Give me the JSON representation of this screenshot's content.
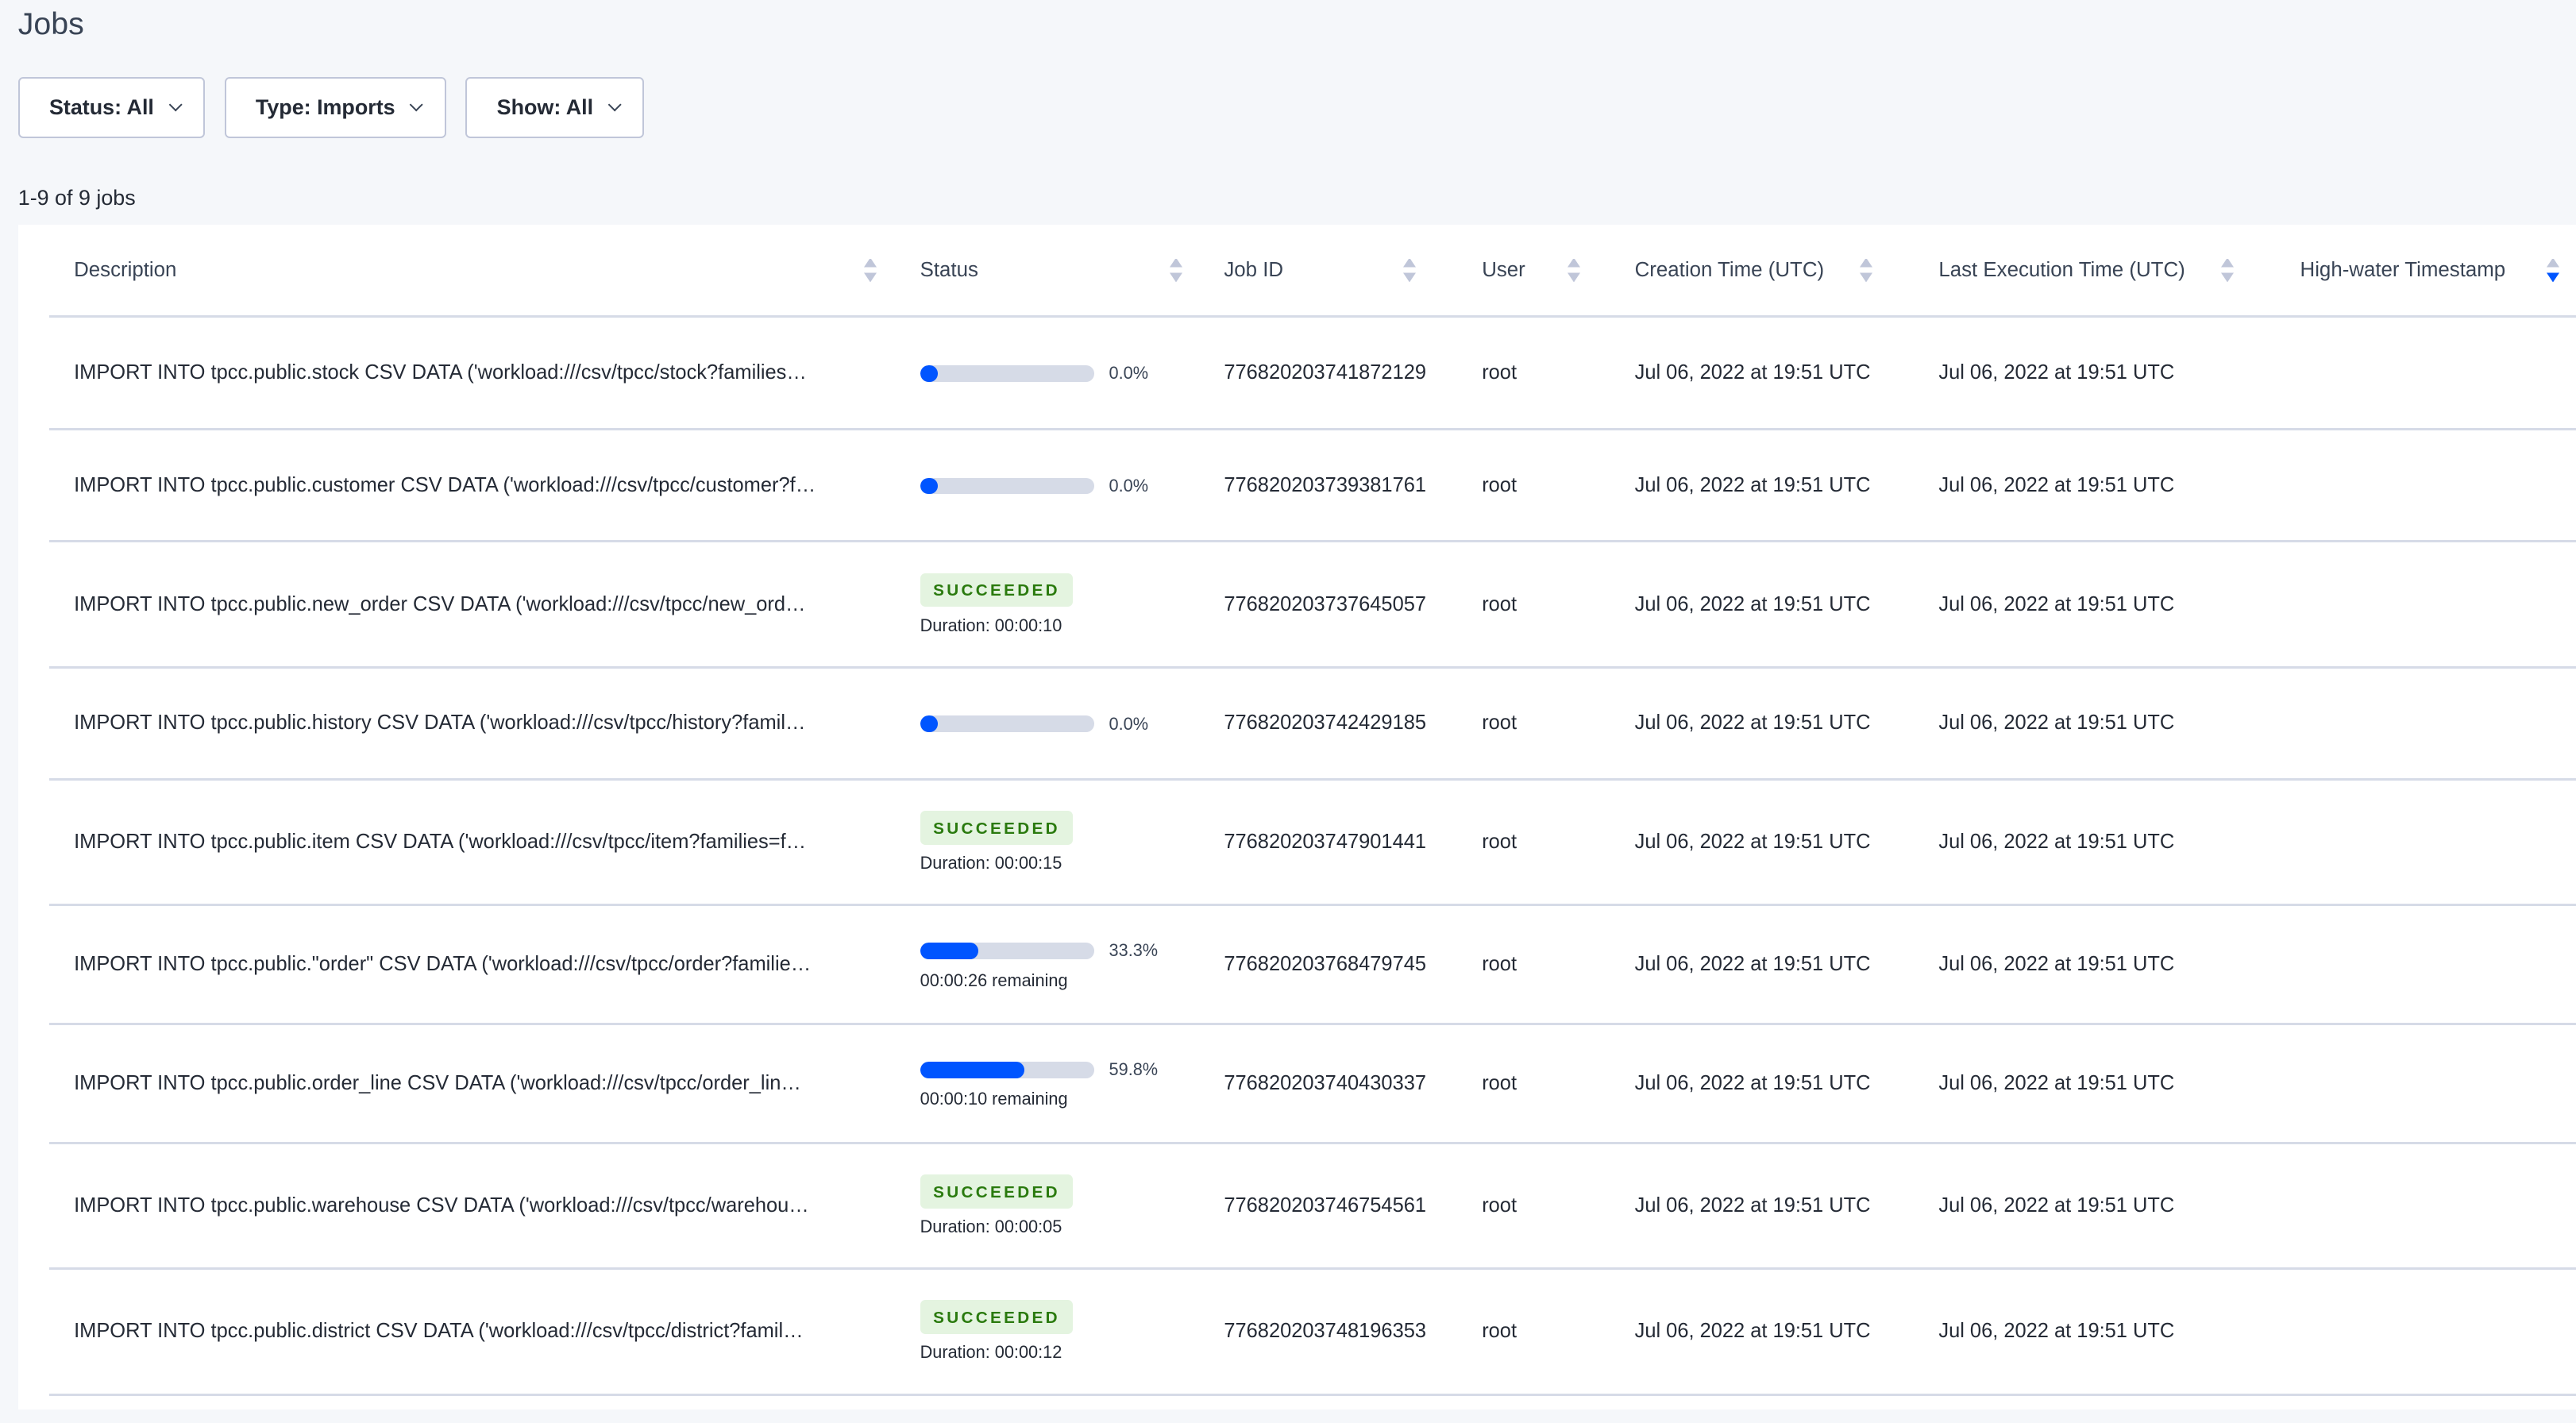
{
  "page": {
    "title": "Jobs",
    "count": "1-9 of 9 jobs"
  },
  "filters": [
    {
      "label": "Status: All"
    },
    {
      "label": "Type: Imports"
    },
    {
      "label": "Show: All"
    }
  ],
  "colors": {
    "accent": "#0055ff",
    "success_bg": "#e4f4e0",
    "success_text": "#2a7a0e"
  },
  "columns": [
    "Description",
    "Status",
    "Job ID",
    "User",
    "Creation Time (UTC)",
    "Last Execution Time (UTC)",
    "High-water Timestamp"
  ],
  "jobs": [
    {
      "description": "IMPORT INTO tpcc.public.stock CSV DATA ('workload:///csv/tpcc/stock?families…",
      "status": "running",
      "progress": 0.0,
      "progress_label": "0.0%",
      "sub": "",
      "job_id": "776820203741872129",
      "user": "root",
      "created": "Jul 06, 2022 at 19:51 UTC",
      "last_exec": "Jul 06, 2022 at 19:51 UTC",
      "high_water": ""
    },
    {
      "description": "IMPORT INTO tpcc.public.customer CSV DATA ('workload:///csv/tpcc/customer?f…",
      "status": "running",
      "progress": 0.0,
      "progress_label": "0.0%",
      "sub": "",
      "job_id": "776820203739381761",
      "user": "root",
      "created": "Jul 06, 2022 at 19:51 UTC",
      "last_exec": "Jul 06, 2022 at 19:51 UTC",
      "high_water": ""
    },
    {
      "description": "IMPORT INTO tpcc.public.new_order CSV DATA ('workload:///csv/tpcc/new_ord…",
      "status": "succeeded",
      "badge": "SUCCEEDED",
      "sub": "Duration: 00:00:10",
      "job_id": "776820203737645057",
      "user": "root",
      "created": "Jul 06, 2022 at 19:51 UTC",
      "last_exec": "Jul 06, 2022 at 19:51 UTC",
      "high_water": ""
    },
    {
      "description": "IMPORT INTO tpcc.public.history CSV DATA ('workload:///csv/tpcc/history?famil…",
      "status": "running",
      "progress": 0.0,
      "progress_label": "0.0%",
      "sub": "",
      "job_id": "776820203742429185",
      "user": "root",
      "created": "Jul 06, 2022 at 19:51 UTC",
      "last_exec": "Jul 06, 2022 at 19:51 UTC",
      "high_water": ""
    },
    {
      "description": "IMPORT INTO tpcc.public.item CSV DATA ('workload:///csv/tpcc/item?families=f…",
      "status": "succeeded",
      "badge": "SUCCEEDED",
      "sub": "Duration: 00:00:15",
      "job_id": "776820203747901441",
      "user": "root",
      "created": "Jul 06, 2022 at 19:51 UTC",
      "last_exec": "Jul 06, 2022 at 19:51 UTC",
      "high_water": ""
    },
    {
      "description": "IMPORT INTO tpcc.public.\"order\" CSV DATA ('workload:///csv/tpcc/order?familie…",
      "status": "running",
      "progress": 33.3,
      "progress_label": "33.3%",
      "sub": "00:00:26 remaining",
      "job_id": "776820203768479745",
      "user": "root",
      "created": "Jul 06, 2022 at 19:51 UTC",
      "last_exec": "Jul 06, 2022 at 19:51 UTC",
      "high_water": ""
    },
    {
      "description": "IMPORT INTO tpcc.public.order_line CSV DATA ('workload:///csv/tpcc/order_lin…",
      "status": "running",
      "progress": 59.8,
      "progress_label": "59.8%",
      "sub": "00:00:10 remaining",
      "job_id": "776820203740430337",
      "user": "root",
      "created": "Jul 06, 2022 at 19:51 UTC",
      "last_exec": "Jul 06, 2022 at 19:51 UTC",
      "high_water": ""
    },
    {
      "description": "IMPORT INTO tpcc.public.warehouse CSV DATA ('workload:///csv/tpcc/warehou…",
      "status": "succeeded",
      "badge": "SUCCEEDED",
      "sub": "Duration: 00:00:05",
      "job_id": "776820203746754561",
      "user": "root",
      "created": "Jul 06, 2022 at 19:51 UTC",
      "last_exec": "Jul 06, 2022 at 19:51 UTC",
      "high_water": ""
    },
    {
      "description": "IMPORT INTO tpcc.public.district CSV DATA ('workload:///csv/tpcc/district?famil…",
      "status": "succeeded",
      "badge": "SUCCEEDED",
      "sub": "Duration: 00:00:12",
      "job_id": "776820203748196353",
      "user": "root",
      "created": "Jul 06, 2022 at 19:51 UTC",
      "last_exec": "Jul 06, 2022 at 19:51 UTC",
      "high_water": ""
    }
  ]
}
